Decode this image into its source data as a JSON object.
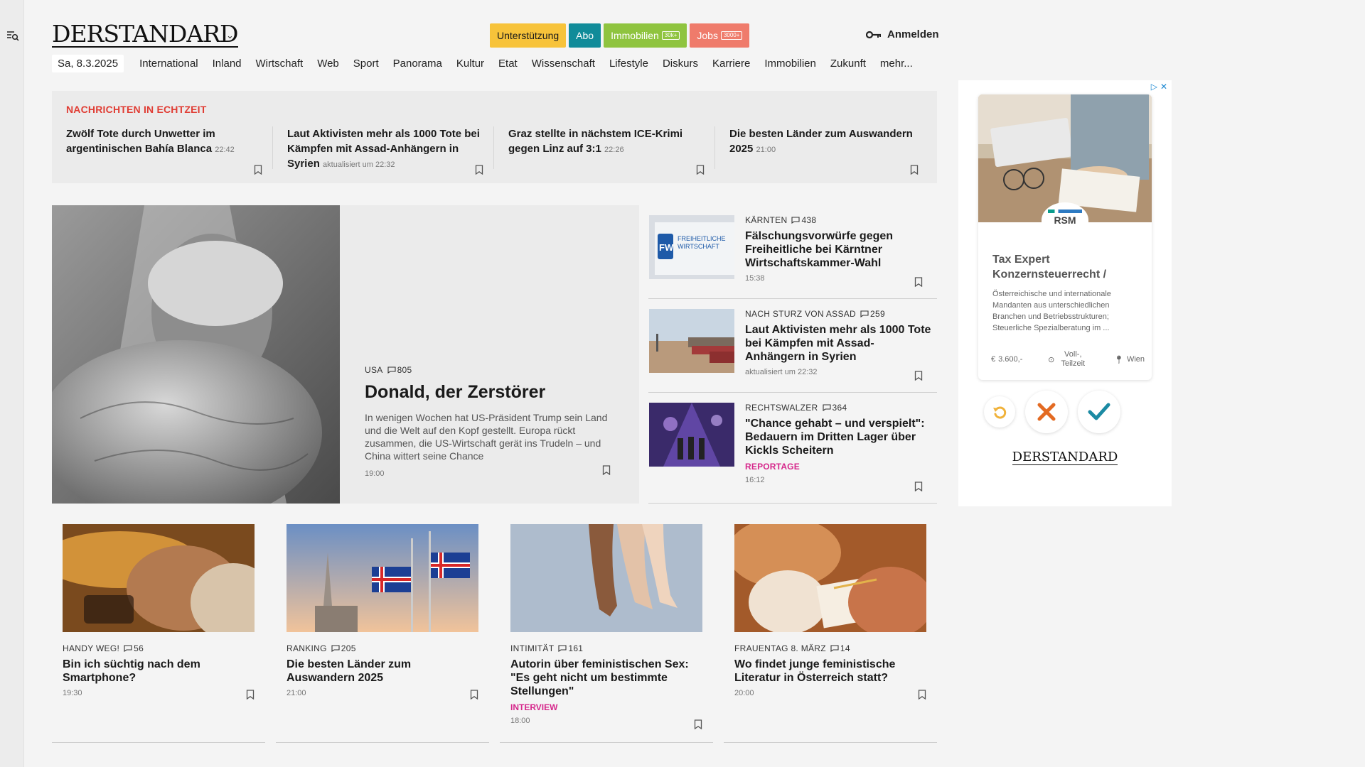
{
  "header": {
    "logo": "DERSTANDARD",
    "buttons": [
      {
        "label": "Unterstützung",
        "badge": ""
      },
      {
        "label": "Abo",
        "badge": ""
      },
      {
        "label": "Immobilien",
        "badge": "30k+"
      },
      {
        "label": "Jobs",
        "badge": "3000+"
      }
    ],
    "login": "Anmelden"
  },
  "nav": {
    "date": "Sa, 8.3.2025",
    "items": [
      "International",
      "Inland",
      "Wirtschaft",
      "Web",
      "Sport",
      "Panorama",
      "Kultur",
      "Etat",
      "Wissenschaft",
      "Lifestyle",
      "Diskurs",
      "Karriere",
      "Immobilien",
      "Zukunft",
      "mehr..."
    ]
  },
  "live": {
    "title": "NACHRICHTEN IN ECHTZEIT",
    "items": [
      {
        "title": "Zwölf Tote durch Unwetter im argentinischen Bahía Blanca",
        "time": "22:42"
      },
      {
        "title": "Laut Aktivisten mehr als 1000 Tote bei Kämpfen mit Assad-Anhängern in Syrien",
        "time": "aktualisiert um 22:32"
      },
      {
        "title": "Graz stellte in nächstem ICE-Krimi gegen Linz auf 3:1",
        "time": "22:26"
      },
      {
        "title": "Die besten Länder zum Auswandern 2025",
        "time": "21:00"
      }
    ]
  },
  "hero": {
    "kicker": "USA",
    "comments": "805",
    "title": "Donald, der Zerstörer",
    "lead": "In wenigen Wochen hat US-Präsident Trump sein Land und die Welt auf den Kopf gestellt. Europa rückt zusammen, die US-Wirtschaft gerät ins Trudeln – und China wittert seine Chance",
    "time": "19:00"
  },
  "side": [
    {
      "kicker": "KÄRNTEN",
      "comments": "438",
      "title": "Fälschungsvorwürfe gegen Freiheitliche bei Kärntner Wirtschaftskammer-Wahl",
      "time": "15:38",
      "tag": ""
    },
    {
      "kicker": "NACH STURZ VON ASSAD",
      "comments": "259",
      "title": "Laut Aktivisten mehr als 1000 Tote bei Kämpfen mit Assad-Anhängern in Syrien",
      "time": "aktualisiert um 22:32",
      "tag": ""
    },
    {
      "kicker": "RECHTSWALZER",
      "comments": "364",
      "title": "\"Chance gehabt – und verspielt\": Bedauern im Dritten Lager über Kickls Scheitern",
      "time": "16:12",
      "tag": "REPORTAGE"
    }
  ],
  "cards": [
    {
      "kicker": "HANDY WEG!",
      "comments": "56",
      "title": "Bin ich süchtig nach dem Smartphone?",
      "time": "19:30",
      "tag": ""
    },
    {
      "kicker": "RANKING",
      "comments": "205",
      "title": "Die besten Länder zum Auswandern 2025",
      "time": "21:00",
      "tag": ""
    },
    {
      "kicker": "INTIMITÄT",
      "comments": "161",
      "title": "Autorin über feministischen Sex: \"Es geht nicht um bestimmte Stellungen\"",
      "time": "18:00",
      "tag": "INTERVIEW"
    },
    {
      "kicker": "FRAUENTAG 8. MÄRZ",
      "comments": "14",
      "title": "Wo findet junge feministische Literatur in Österreich statt?",
      "time": "20:00",
      "tag": ""
    }
  ],
  "ad": {
    "logo": "RSM",
    "title": "Tax Expert Konzernsteuerrecht /",
    "desc": "Österreichische und internationale Mandanten aus unterschiedlichen Branchen und Betriebsstrukturen; Steuerliche Spezialberatung im ...",
    "salary": "3.600,-",
    "hours": "Voll-, Teilzeit",
    "location": "Wien",
    "brand": "DERSTANDARD"
  },
  "colors": {
    "accent_red": "#e03c33",
    "tag_magenta": "#d6278b",
    "btn_yellow": "#f7c33a",
    "btn_teal": "#108b99",
    "btn_green": "#8fc43f",
    "btn_red": "#ef7b6b"
  }
}
